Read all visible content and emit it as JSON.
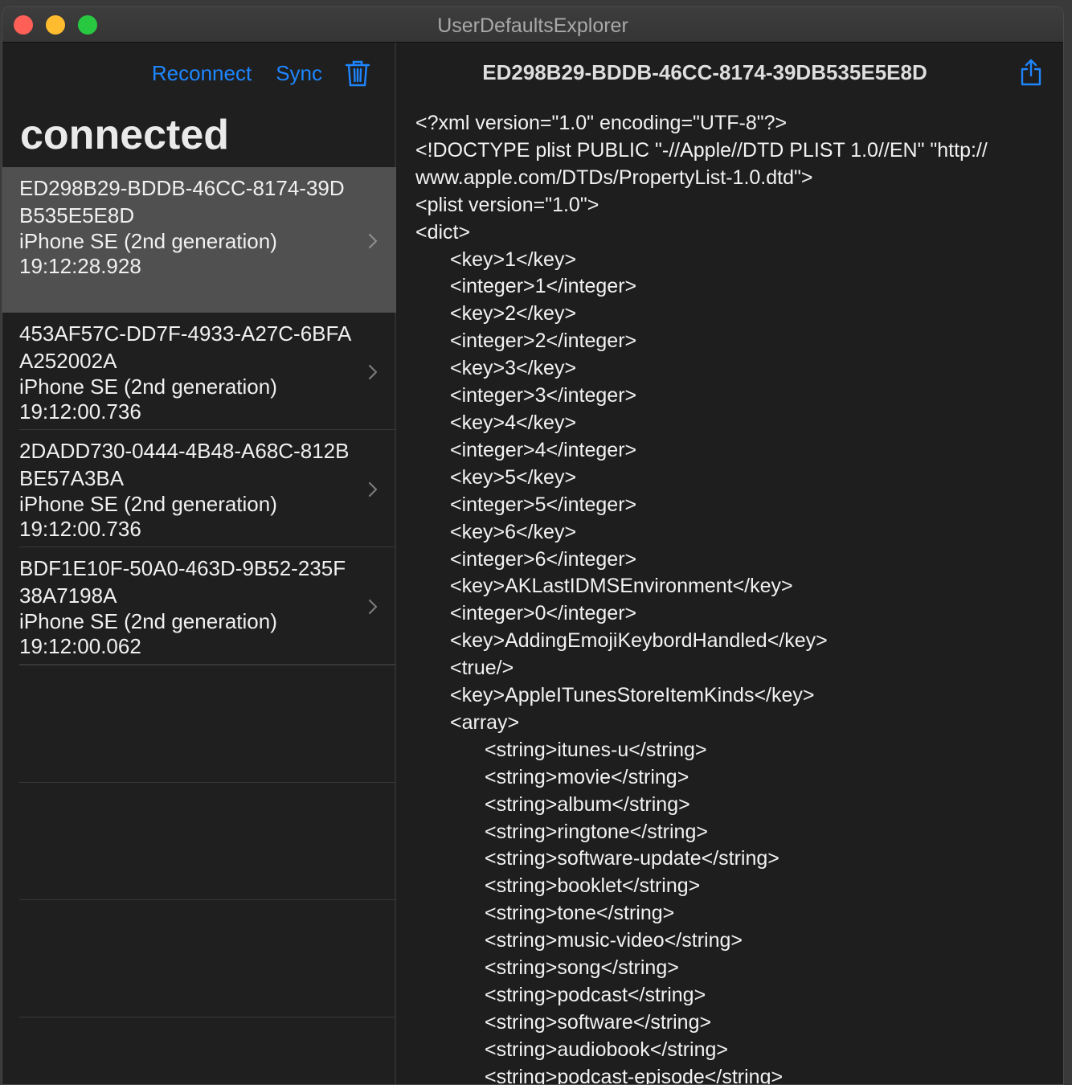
{
  "window": {
    "title": "UserDefaultsExplorer"
  },
  "toolbar": {
    "reconnect_label": "Reconnect",
    "sync_label": "Sync"
  },
  "sidebar": {
    "heading": "connected",
    "devices": [
      {
        "uuid": "ED298B29-BDDB-46CC-8174-39DB535E5E8D",
        "model": "iPhone SE (2nd generation)",
        "time": "19:12:28.928",
        "selected": true
      },
      {
        "uuid": "453AF57C-DD7F-4933-A27C-6BFAA252002A",
        "model": "iPhone SE (2nd generation)",
        "time": "19:12:00.736",
        "selected": false
      },
      {
        "uuid": "2DADD730-0444-4B48-A68C-812BBE57A3BA",
        "model": "iPhone SE (2nd generation)",
        "time": "19:12:00.736",
        "selected": false
      },
      {
        "uuid": "BDF1E10F-50A0-463D-9B52-235F38A7198A",
        "model": "iPhone SE (2nd generation)",
        "time": "19:12:00.062",
        "selected": false
      }
    ]
  },
  "detail": {
    "title": "ED298B29-BDDB-46CC-8174-39DB535E5E8D",
    "plist_lines": [
      "<?xml version=\"1.0\" encoding=\"UTF-8\"?>",
      "<!DOCTYPE plist PUBLIC \"-//Apple//DTD PLIST 1.0//EN\" \"http://",
      "www.apple.com/DTDs/PropertyList-1.0.dtd\">",
      "<plist version=\"1.0\">",
      "<dict>",
      "\t<key>1</key>",
      "\t<integer>1</integer>",
      "\t<key>2</key>",
      "\t<integer>2</integer>",
      "\t<key>3</key>",
      "\t<integer>3</integer>",
      "\t<key>4</key>",
      "\t<integer>4</integer>",
      "\t<key>5</key>",
      "\t<integer>5</integer>",
      "\t<key>6</key>",
      "\t<integer>6</integer>",
      "\t<key>AKLastIDMSEnvironment</key>",
      "\t<integer>0</integer>",
      "\t<key>AddingEmojiKeybordHandled</key>",
      "\t<true/>",
      "\t<key>AppleITunesStoreItemKinds</key>",
      "\t<array>",
      "\t\t<string>itunes-u</string>",
      "\t\t<string>movie</string>",
      "\t\t<string>album</string>",
      "\t\t<string>ringtone</string>",
      "\t\t<string>software-update</string>",
      "\t\t<string>booklet</string>",
      "\t\t<string>tone</string>",
      "\t\t<string>music-video</string>",
      "\t\t<string>song</string>",
      "\t\t<string>podcast</string>",
      "\t\t<string>software</string>",
      "\t\t<string>audiobook</string>",
      "\t\t<string>podcast-episode</string>"
    ]
  },
  "colors": {
    "accent": "#1e86ff",
    "selection": "#505050",
    "background": "#1e1e1e"
  },
  "icons": {
    "trash": "trash-icon",
    "share": "share-icon",
    "chevron": "chevron-right-icon"
  }
}
